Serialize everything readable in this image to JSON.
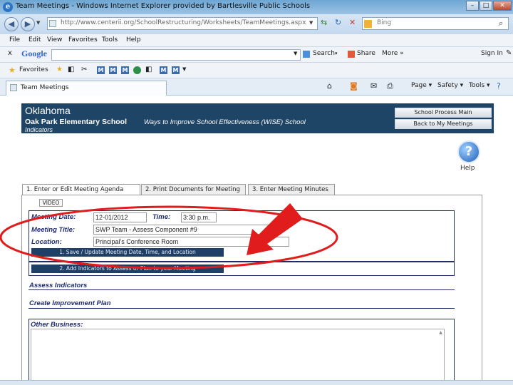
{
  "window": {
    "title": "Team Meetings - Windows Internet Explorer provided by Bartlesville Public Schools",
    "btn_min": "–",
    "btn_max": "□",
    "btn_close": "✕"
  },
  "address": {
    "url": "http://www.centerii.org/SchoolRestructuring/Worksheets/TeamMeetings.aspx",
    "search_placeholder": "Bing"
  },
  "menu": [
    "File",
    "Edit",
    "View",
    "Favorites",
    "Tools",
    "Help"
  ],
  "google": {
    "close": "x",
    "logo": "Google",
    "search_label": "Search",
    "share_label": "Share",
    "more_label": "More »",
    "signin_label": "Sign In"
  },
  "favorites": {
    "label": "Favorites"
  },
  "browser_tab": {
    "label": "Team Meetings"
  },
  "commandbar": {
    "page": "Page ▾",
    "safety": "Safety ▾",
    "tools": "Tools ▾"
  },
  "banner": {
    "state": "Oklahoma",
    "school": "Oak Park Elementary School",
    "wise": "Ways to Improve School Effectiveness (WISE)   School",
    "indicators": "Indicators",
    "btn_main": "School Process Main",
    "btn_meetings": "Back to My Meetings"
  },
  "help": {
    "glyph": "?",
    "label": "Help"
  },
  "page_tabs": [
    "1.  Enter or Edit Meeting Agenda",
    "2.  Print Documents for Meeting",
    "3.  Enter Meeting Minutes"
  ],
  "video_label": "VIDEO",
  "meeting": {
    "date_label": "Meeting Date:",
    "date_value": "12-01/2012",
    "time_label": "Time:",
    "time_value": "3:30 p.m.",
    "title_label": "Meeting Title:",
    "title_value": "SWP Team - Assess Component #9",
    "location_label": "Location:",
    "location_value": "Principal's Conference Room",
    "save_button": "1. Save / Update Meeting Date, Time, and Location",
    "add_indicators_button": "2. Add Indicators to Assess or Plan to your Meeting"
  },
  "sections": {
    "assess": "Assess Indicators",
    "improve": "Create Improvement Plan",
    "other": "Other Business:"
  },
  "colors": {
    "banner_bg": "#1f4566",
    "label_blue": "#1f2b73",
    "annotation_red": "#e01c1c"
  }
}
